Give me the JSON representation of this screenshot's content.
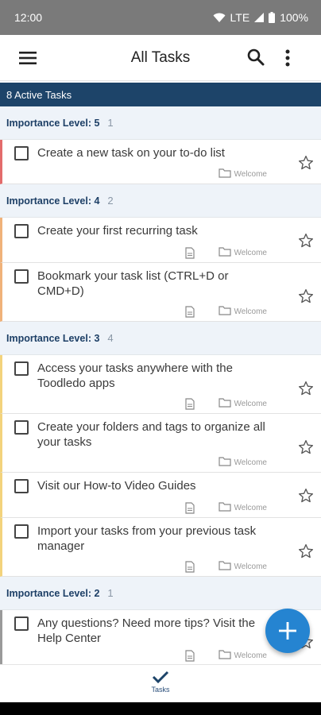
{
  "status": {
    "time": "12:00",
    "network": "LTE",
    "battery": "100%"
  },
  "app_bar": {
    "title": "All Tasks"
  },
  "active_bar": {
    "label": "8 Active Tasks"
  },
  "groups": [
    {
      "label": "Importance Level: 5",
      "count": "1",
      "tasks": [
        {
          "title": "Create a new task on your to-do list",
          "folder": "Welcome",
          "has_note": false
        }
      ]
    },
    {
      "label": "Importance Level: 4",
      "count": "2",
      "tasks": [
        {
          "title": "Create your first recurring task",
          "folder": "Welcome",
          "has_note": true
        },
        {
          "title": "Bookmark your task list (CTRL+D or CMD+D)",
          "folder": "Welcome",
          "has_note": true
        }
      ]
    },
    {
      "label": "Importance Level: 3",
      "count": "4",
      "tasks": [
        {
          "title": "Access your tasks anywhere with the Toodledo apps",
          "folder": "Welcome",
          "has_note": true
        },
        {
          "title": "Create your folders and tags to organize all your tasks",
          "folder": "Welcome",
          "has_note": false
        },
        {
          "title": "Visit our How-to Video Guides",
          "folder": "Welcome",
          "has_note": true
        },
        {
          "title": "Import your tasks from your previous task manager",
          "folder": "Welcome",
          "has_note": true
        }
      ]
    },
    {
      "label": "Importance Level: 2",
      "count": "1",
      "tasks": [
        {
          "title": "Any questions? Need more tips? Visit the Help Center",
          "folder": "Welcome",
          "has_note": true
        }
      ]
    }
  ],
  "bottom_nav": {
    "tasks_label": "Tasks"
  },
  "colors": {
    "header_bar": "#1d4469",
    "fab": "#2584d1",
    "imp5": "#e36b6b",
    "imp4": "#f0b27a",
    "imp3": "#f3d37c",
    "imp2": "#9a9a9a"
  }
}
